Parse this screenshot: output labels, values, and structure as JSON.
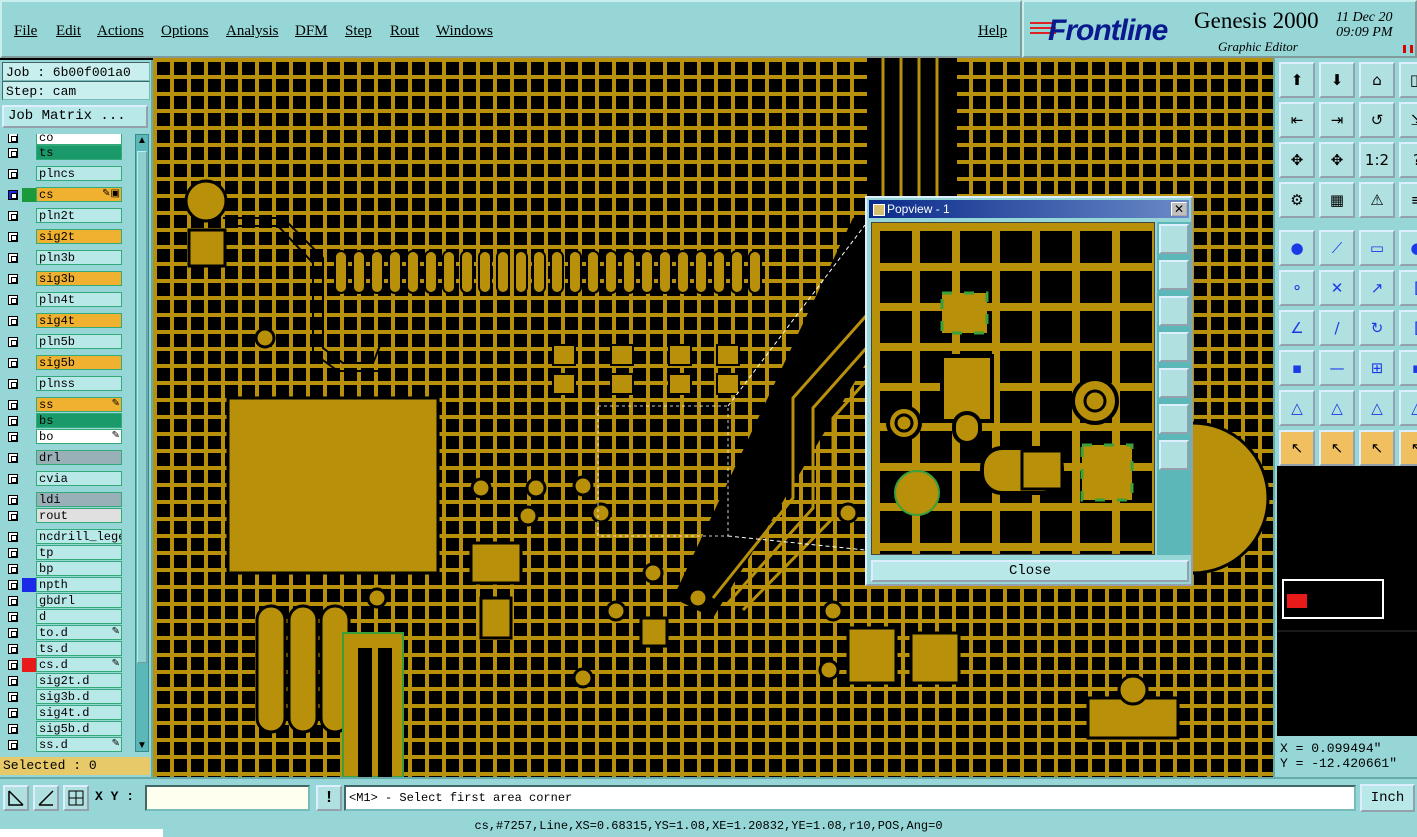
{
  "menu": [
    "File",
    "Edit",
    "Actions",
    "Options",
    "Analysis",
    "DFM",
    "Step",
    "Rout",
    "Windows"
  ],
  "help": "Help",
  "brand": {
    "logo": "Frontline",
    "app_name": "Genesis 2000",
    "subtitle": "Graphic Editor",
    "date": "11 Dec 20",
    "time": "09:09 PM"
  },
  "left": {
    "job": "Job : 6b00f001a0",
    "step": "Step: cam",
    "job_matrix": "Job Matrix ...",
    "selected": "Selected : 0",
    "layers": [
      {
        "name": "co",
        "bg": "#ffffff",
        "color": "",
        "mark": ""
      },
      {
        "name": "ts",
        "bg": "#1a9a6a",
        "color": "",
        "mark": ""
      },
      {
        "name": "plncs",
        "bg": "#b8e8e8",
        "color": "",
        "mark": ""
      },
      {
        "name": "cs",
        "bg": "#f0b030",
        "color": "#1a9a3a",
        "mark": "✎▣",
        "active": true
      },
      {
        "name": "pln2t",
        "bg": "#b8e8e8",
        "color": "",
        "mark": ""
      },
      {
        "name": "sig2t",
        "bg": "#f0b030",
        "color": "",
        "mark": ""
      },
      {
        "name": "pln3b",
        "bg": "#b8e8e8",
        "color": "",
        "mark": ""
      },
      {
        "name": "sig3b",
        "bg": "#f0b030",
        "color": "",
        "mark": ""
      },
      {
        "name": "pln4t",
        "bg": "#b8e8e8",
        "color": "",
        "mark": ""
      },
      {
        "name": "sig4t",
        "bg": "#f0b030",
        "color": "",
        "mark": ""
      },
      {
        "name": "pln5b",
        "bg": "#b8e8e8",
        "color": "",
        "mark": ""
      },
      {
        "name": "sig5b",
        "bg": "#f0b030",
        "color": "",
        "mark": ""
      },
      {
        "name": "plnss",
        "bg": "#b8e8e8",
        "color": "",
        "mark": ""
      },
      {
        "name": "ss",
        "bg": "#f0b030",
        "color": "",
        "mark": "✎"
      },
      {
        "name": "bs",
        "bg": "#1a9a6a",
        "color": "",
        "mark": ""
      },
      {
        "name": "bo",
        "bg": "#ffffff",
        "color": "",
        "mark": "✎"
      },
      {
        "name": "drl",
        "bg": "#9ab0b8",
        "color": "",
        "mark": ""
      },
      {
        "name": "cvia",
        "bg": "#b8e8e8",
        "color": "",
        "mark": ""
      },
      {
        "name": "ldi",
        "bg": "#9ab0b8",
        "color": "",
        "mark": ""
      },
      {
        "name": "rout",
        "bg": "#e0e0e0",
        "color": "",
        "mark": ""
      },
      {
        "name": "ncdrill_lege",
        "bg": "#b8e8e8",
        "color": "",
        "mark": ""
      },
      {
        "name": "tp",
        "bg": "#b8e8e8",
        "color": "",
        "mark": ""
      },
      {
        "name": "bp",
        "bg": "#b8e8e8",
        "color": "",
        "mark": ""
      },
      {
        "name": "npth",
        "bg": "#b8e8e8",
        "color": "#1a2ae8",
        "mark": ""
      },
      {
        "name": "gbdrl",
        "bg": "#b8e8e8",
        "color": "",
        "mark": ""
      },
      {
        "name": "d",
        "bg": "#b8e8e8",
        "color": "",
        "mark": ""
      },
      {
        "name": "to.d",
        "bg": "#b8e8e8",
        "color": "",
        "mark": "✎"
      },
      {
        "name": "ts.d",
        "bg": "#b8e8e8",
        "color": "",
        "mark": ""
      },
      {
        "name": "cs.d",
        "bg": "#b8e8e8",
        "color": "#e81a1a",
        "mark": "✎"
      },
      {
        "name": "sig2t.d",
        "bg": "#b8e8e8",
        "color": "",
        "mark": ""
      },
      {
        "name": "sig3b.d",
        "bg": "#b8e8e8",
        "color": "",
        "mark": ""
      },
      {
        "name": "sig4t.d",
        "bg": "#b8e8e8",
        "color": "",
        "mark": ""
      },
      {
        "name": "sig5b.d",
        "bg": "#b8e8e8",
        "color": "",
        "mark": ""
      },
      {
        "name": "ss.d",
        "bg": "#b8e8e8",
        "color": "",
        "mark": "✎"
      }
    ]
  },
  "popview": {
    "title": "Popview - 1",
    "close_label": "Close"
  },
  "right": {
    "x": "X = 0.099494\"",
    "y": "Y = -12.420661\""
  },
  "bottom": {
    "xy_label": "X Y :",
    "xy_value": "",
    "prompt": "<M1> - Select first area corner",
    "unit": "Inch",
    "status": "cs,#7257,Line,XS=0.68315,YS=1.08,XE=1.20832,YE=1.08,r10,POS,Ang=0"
  },
  "colors": {
    "copper": "#b8900a",
    "background": "#000000",
    "panel": "#96d6d6",
    "silk": "#3aa03a"
  }
}
